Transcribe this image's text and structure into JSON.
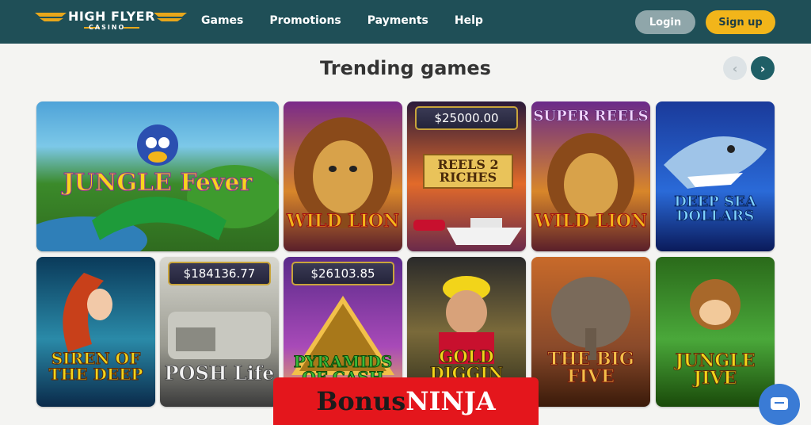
{
  "brand": {
    "name": "HIGH FLYER",
    "sub": "CASINO"
  },
  "nav": [
    "Games",
    "Promotions",
    "Payments",
    "Help"
  ],
  "auth": {
    "login": "Login",
    "signup": "Sign up"
  },
  "section": {
    "title": "Trending games"
  },
  "games": [
    {
      "title": "JUNGLE Fever",
      "jackpot": ""
    },
    {
      "title": "WILD LION",
      "jackpot": ""
    },
    {
      "title": "REELS 2 RICHES",
      "jackpot": "$25000.00"
    },
    {
      "title": "WILD LION",
      "header": "SUPER REELS",
      "jackpot": ""
    },
    {
      "title": "DEEP SEA DOLLARS",
      "jackpot": ""
    },
    {
      "title": "SIREN OF THE DEEP",
      "jackpot": ""
    },
    {
      "title": "POSH Life",
      "jackpot": "$184136.77"
    },
    {
      "title": "PYRAMIDS OF CASH",
      "jackpot": "$26103.85"
    },
    {
      "title": "GOLD DIGGIN",
      "jackpot": ""
    },
    {
      "title": "THE BIG FIVE",
      "jackpot": ""
    },
    {
      "title": "JUNGLE JIVE",
      "jackpot": ""
    }
  ],
  "banner": {
    "part1": "Bonus",
    "part2": "NINJA"
  },
  "colors": {
    "header": "#1f4f57",
    "signup": "#f2b51a",
    "login": "#8fa6aa",
    "banner": "#e4161c"
  }
}
